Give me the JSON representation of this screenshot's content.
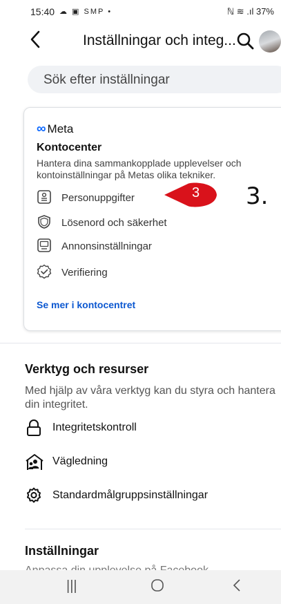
{
  "status_bar": {
    "time": "15:40",
    "notif_icons": "☁ ▣ SMP •",
    "right": "ℕ ≋ .ıl 37%"
  },
  "header": {
    "title": "Inställningar och integ...",
    "back_icon": "back-arrow",
    "search_icon": "search"
  },
  "search": {
    "placeholder": "Sök efter inställningar"
  },
  "accounts_center": {
    "brand": "Meta",
    "brand_symbol": "∞",
    "title": "Kontocenter",
    "description": "Hantera dina sammankopplade upplevelser och kontoinställningar på Metas olika tekniker.",
    "items": [
      {
        "label": "Personuppgifter",
        "icon": "id-card"
      },
      {
        "label": "Lösenord och säkerhet",
        "icon": "shield"
      },
      {
        "label": "Annonsinställningar",
        "icon": "monitor"
      },
      {
        "label": "Verifiering",
        "icon": "verified-badge"
      }
    ],
    "link": "Se mer i kontocentret"
  },
  "tools": {
    "title": "Verktyg och resurser",
    "description": "Med hjälp av våra verktyg kan du styra och hantera din integritet.",
    "items": [
      {
        "label": "Integritetskontroll",
        "icon": "lock"
      },
      {
        "label": "Vägledning",
        "icon": "people-house"
      },
      {
        "label": "Standardmålgruppsinställningar",
        "icon": "gear"
      }
    ]
  },
  "settings": {
    "title": "Inställningar",
    "cut_text": "Anpassa din upplevelse på Facebook"
  },
  "annotation": {
    "badge_number": "3",
    "step_label": "3.",
    "badge_color": "#d9121b"
  },
  "navbar": {
    "recent": "|||",
    "home": "○",
    "back": "<"
  }
}
